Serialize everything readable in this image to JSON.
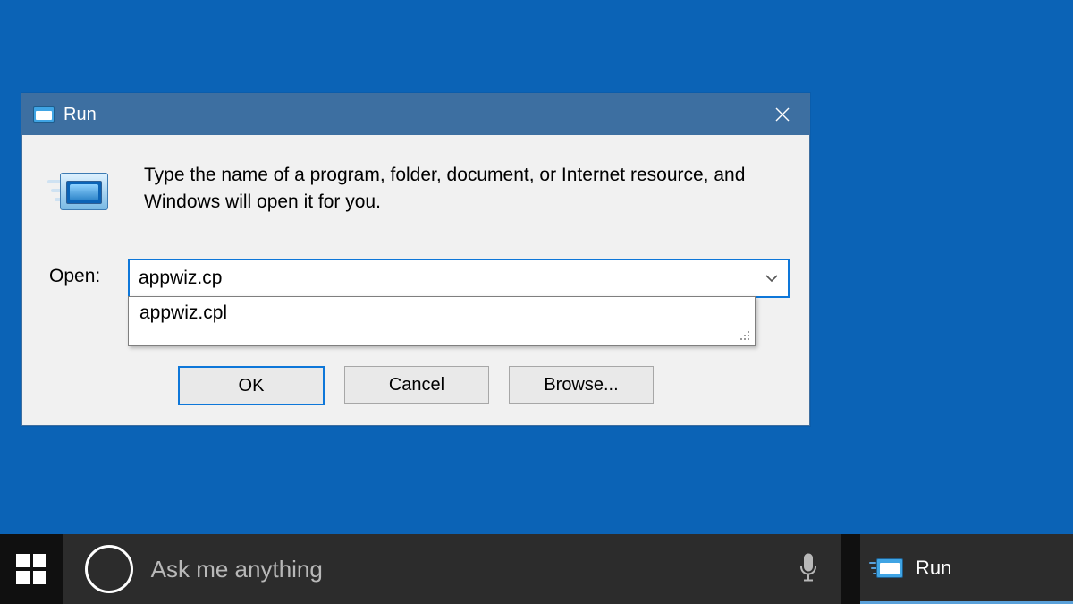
{
  "dialog": {
    "title": "Run",
    "description": "Type the name of a program, folder, document, or Internet resource, and Windows will open it for you.",
    "open_label": "Open:",
    "input_value": "appwiz.cp",
    "suggestions": [
      "appwiz.cpl"
    ],
    "buttons": {
      "ok": "OK",
      "cancel": "Cancel",
      "browse": "Browse..."
    }
  },
  "taskbar": {
    "search_placeholder": "Ask me anything",
    "items": [
      {
        "label": "Run"
      }
    ]
  }
}
